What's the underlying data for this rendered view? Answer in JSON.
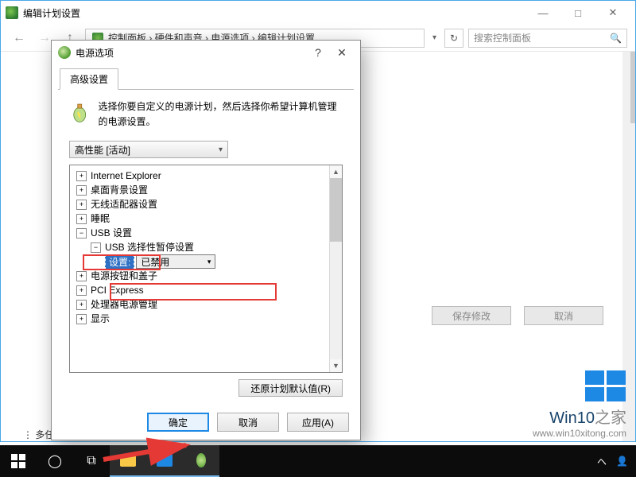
{
  "bg": {
    "title": "编辑计划设置",
    "breadcrumb": "控制面板 › 硬件和声音 › 电源选项 › 编辑计划设置",
    "search_placeholder": "搜索控制面板",
    "save_btn": "保存修改",
    "cancel_btn": "取消",
    "bottom_text": "多任务处理"
  },
  "dialog": {
    "title": "电源选项",
    "help_symbol": "?",
    "close_symbol": "✕",
    "tab": "高级设置",
    "description": "选择你要自定义的电源计划，然后选择你希望计算机管理的电源设置。",
    "plan_selected": "高性能 [活动]",
    "setting_label": "设置:",
    "setting_value": "已禁用",
    "restore_btn": "还原计划默认值(R)",
    "ok_btn": "确定",
    "cancel_btn": "取消",
    "apply_btn": "应用(A)"
  },
  "tree": [
    {
      "level": 0,
      "expanded": false,
      "label": "Internet Explorer"
    },
    {
      "level": 0,
      "expanded": false,
      "label": "桌面背景设置"
    },
    {
      "level": 0,
      "expanded": false,
      "label": "无线适配器设置"
    },
    {
      "level": 0,
      "expanded": false,
      "label": "睡眠"
    },
    {
      "level": 0,
      "expanded": true,
      "label": "USB 设置"
    },
    {
      "level": 1,
      "expanded": true,
      "label": "USB 选择性暂停设置"
    },
    {
      "level": 2,
      "expanded": null,
      "label": "__SETTING__"
    },
    {
      "level": 0,
      "expanded": false,
      "label": "电源按钮和盖子"
    },
    {
      "level": 0,
      "expanded": false,
      "label": "PCI Express"
    },
    {
      "level": 0,
      "expanded": false,
      "label": "处理器电源管理"
    },
    {
      "level": 0,
      "expanded": false,
      "label": "显示"
    }
  ],
  "watermark": {
    "brand_a": "Win10",
    "brand_b": "之家",
    "url": "www.win10xitong.com"
  },
  "taskbar": {
    "tray_up": "ヘ",
    "tray_net": "⧉",
    "tray_people": "👤"
  }
}
